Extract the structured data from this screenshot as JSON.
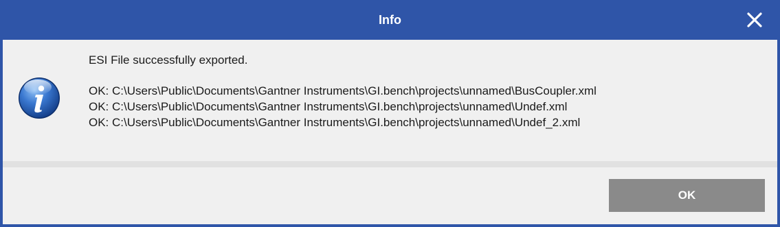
{
  "window": {
    "title": "Info",
    "close_icon": "close-icon"
  },
  "message": {
    "icon": "info-icon",
    "headline": "ESI File successfully exported.",
    "lines": [
      "OK: C:\\Users\\Public\\Documents\\Gantner Instruments\\GI.bench\\projects\\unnamed\\BusCoupler.xml",
      "OK: C:\\Users\\Public\\Documents\\Gantner Instruments\\GI.bench\\projects\\unnamed\\Undef.xml",
      "OK: C:\\Users\\Public\\Documents\\Gantner Instruments\\GI.bench\\projects\\unnamed\\Undef_2.xml"
    ]
  },
  "footer": {
    "ok_label": "OK"
  },
  "colors": {
    "titlebar": "#2f55a8",
    "button": "#8a8a8a",
    "background": "#f0f0f0"
  }
}
